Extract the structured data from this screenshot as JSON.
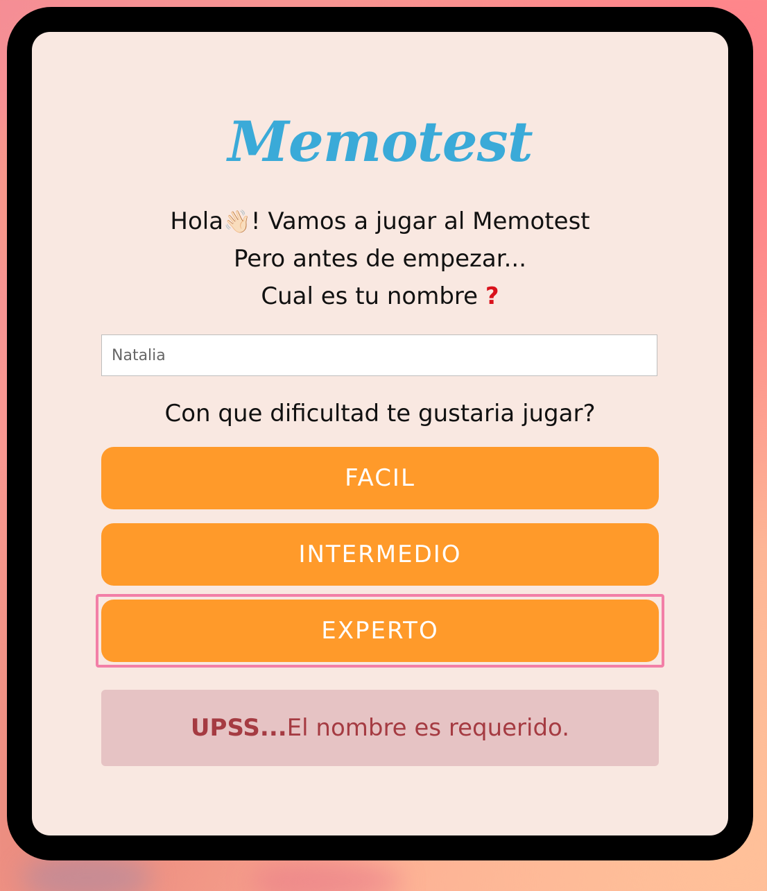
{
  "app": {
    "title": "Memotest"
  },
  "greeting": {
    "hello": "Hola",
    "wave_emoji": "👋🏻",
    "rest": "! Vamos a jugar al Memotest",
    "line2": "Pero antes de empezar...",
    "line3": "Cual es tu nombre ",
    "question_mark": "?"
  },
  "name_field": {
    "placeholder": "Natalia",
    "value": ""
  },
  "difficulty": {
    "prompt": "Con que dificultad te gustaria jugar?",
    "buttons": [
      "FACIL",
      "INTERMEDIO",
      "EXPERTO"
    ],
    "focused": "EXPERTO"
  },
  "error": {
    "strong": "UPSS...",
    "message": "El nombre es requerido."
  },
  "colors": {
    "logo": "#3aaad8",
    "button": "#ff9a2a",
    "card": "#f9e8e1",
    "alert_bg": "#e6c3c4",
    "alert_text": "#a53b42",
    "focus_ring": "#f27fa7"
  }
}
